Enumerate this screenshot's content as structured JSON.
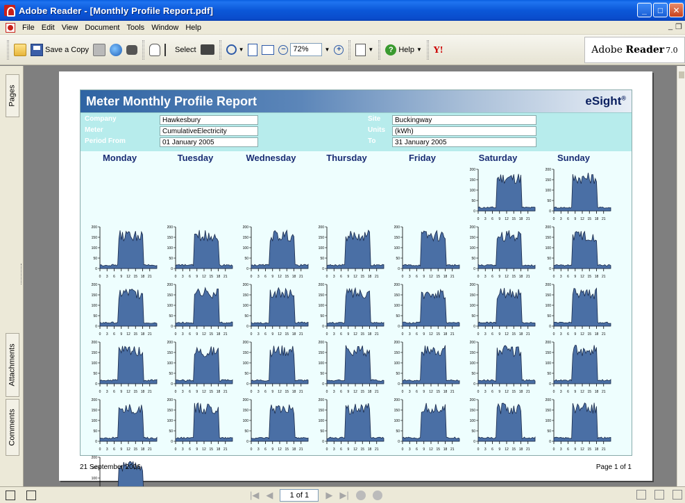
{
  "window": {
    "title": "Adobe Reader - [Monthly Profile Report.pdf]"
  },
  "menu": [
    "File",
    "Edit",
    "View",
    "Document",
    "Tools",
    "Window",
    "Help"
  ],
  "toolbar": {
    "save_copy": "Save a Copy",
    "select": "Select",
    "zoom_value": "72%",
    "help": "Help",
    "yahoo": "Y!",
    "adobe_brand": "Adobe",
    "adobe_product": "Reader",
    "adobe_version": "7.0"
  },
  "nav_tabs": {
    "pages": "Pages",
    "attachments": "Attachments",
    "comments": "Comments"
  },
  "report": {
    "title": "Meter Monthly Profile Report",
    "brand": "eSight",
    "brand_mark": "®",
    "fields": {
      "company_label": "Company",
      "company_value": "Hawkesbury",
      "meter_label": "Meter",
      "meter_value": "CumulativeElectricity",
      "period_from_label": "Period From",
      "period_from_value": "01 January 2005",
      "site_label": "Site",
      "site_value": "Buckingway",
      "units_label": "Units",
      "units_value": "(kWh)",
      "to_label": "To",
      "to_value": "31 January 2005"
    },
    "days": [
      "Monday",
      "Tuesday",
      "Wednesday",
      "Thursday",
      "Friday",
      "Saturday",
      "Sunday"
    ],
    "footer_date": "21 September 2006",
    "footer_page": "Page 1 of 1"
  },
  "chart_data": {
    "type": "area",
    "description_grid": "31 daily load profiles (Jan 2005) laid out Mon–Sun; 1 January 2005 is a Saturday",
    "x_ticks": [
      0,
      3,
      6,
      9,
      12,
      15,
      18,
      21
    ],
    "y_ticks": [
      0,
      50,
      100,
      150,
      200
    ],
    "xlim": [
      0,
      24
    ],
    "ylim": [
      0,
      200
    ],
    "first_weekday_index": 5,
    "days_count": 31,
    "profile_shape": {
      "night_level": 12,
      "on_hour": 8,
      "off_hour": 18,
      "day_peak_range": [
        130,
        185
      ]
    }
  },
  "statusbar": {
    "page_field": "1 of 1"
  },
  "colors": {
    "area_fill": "#4a6fa5",
    "area_stroke": "#1a2a4a",
    "report_bg": "#eefefe",
    "header_band": "#b7ecec",
    "day_label": "#1a2d74"
  }
}
